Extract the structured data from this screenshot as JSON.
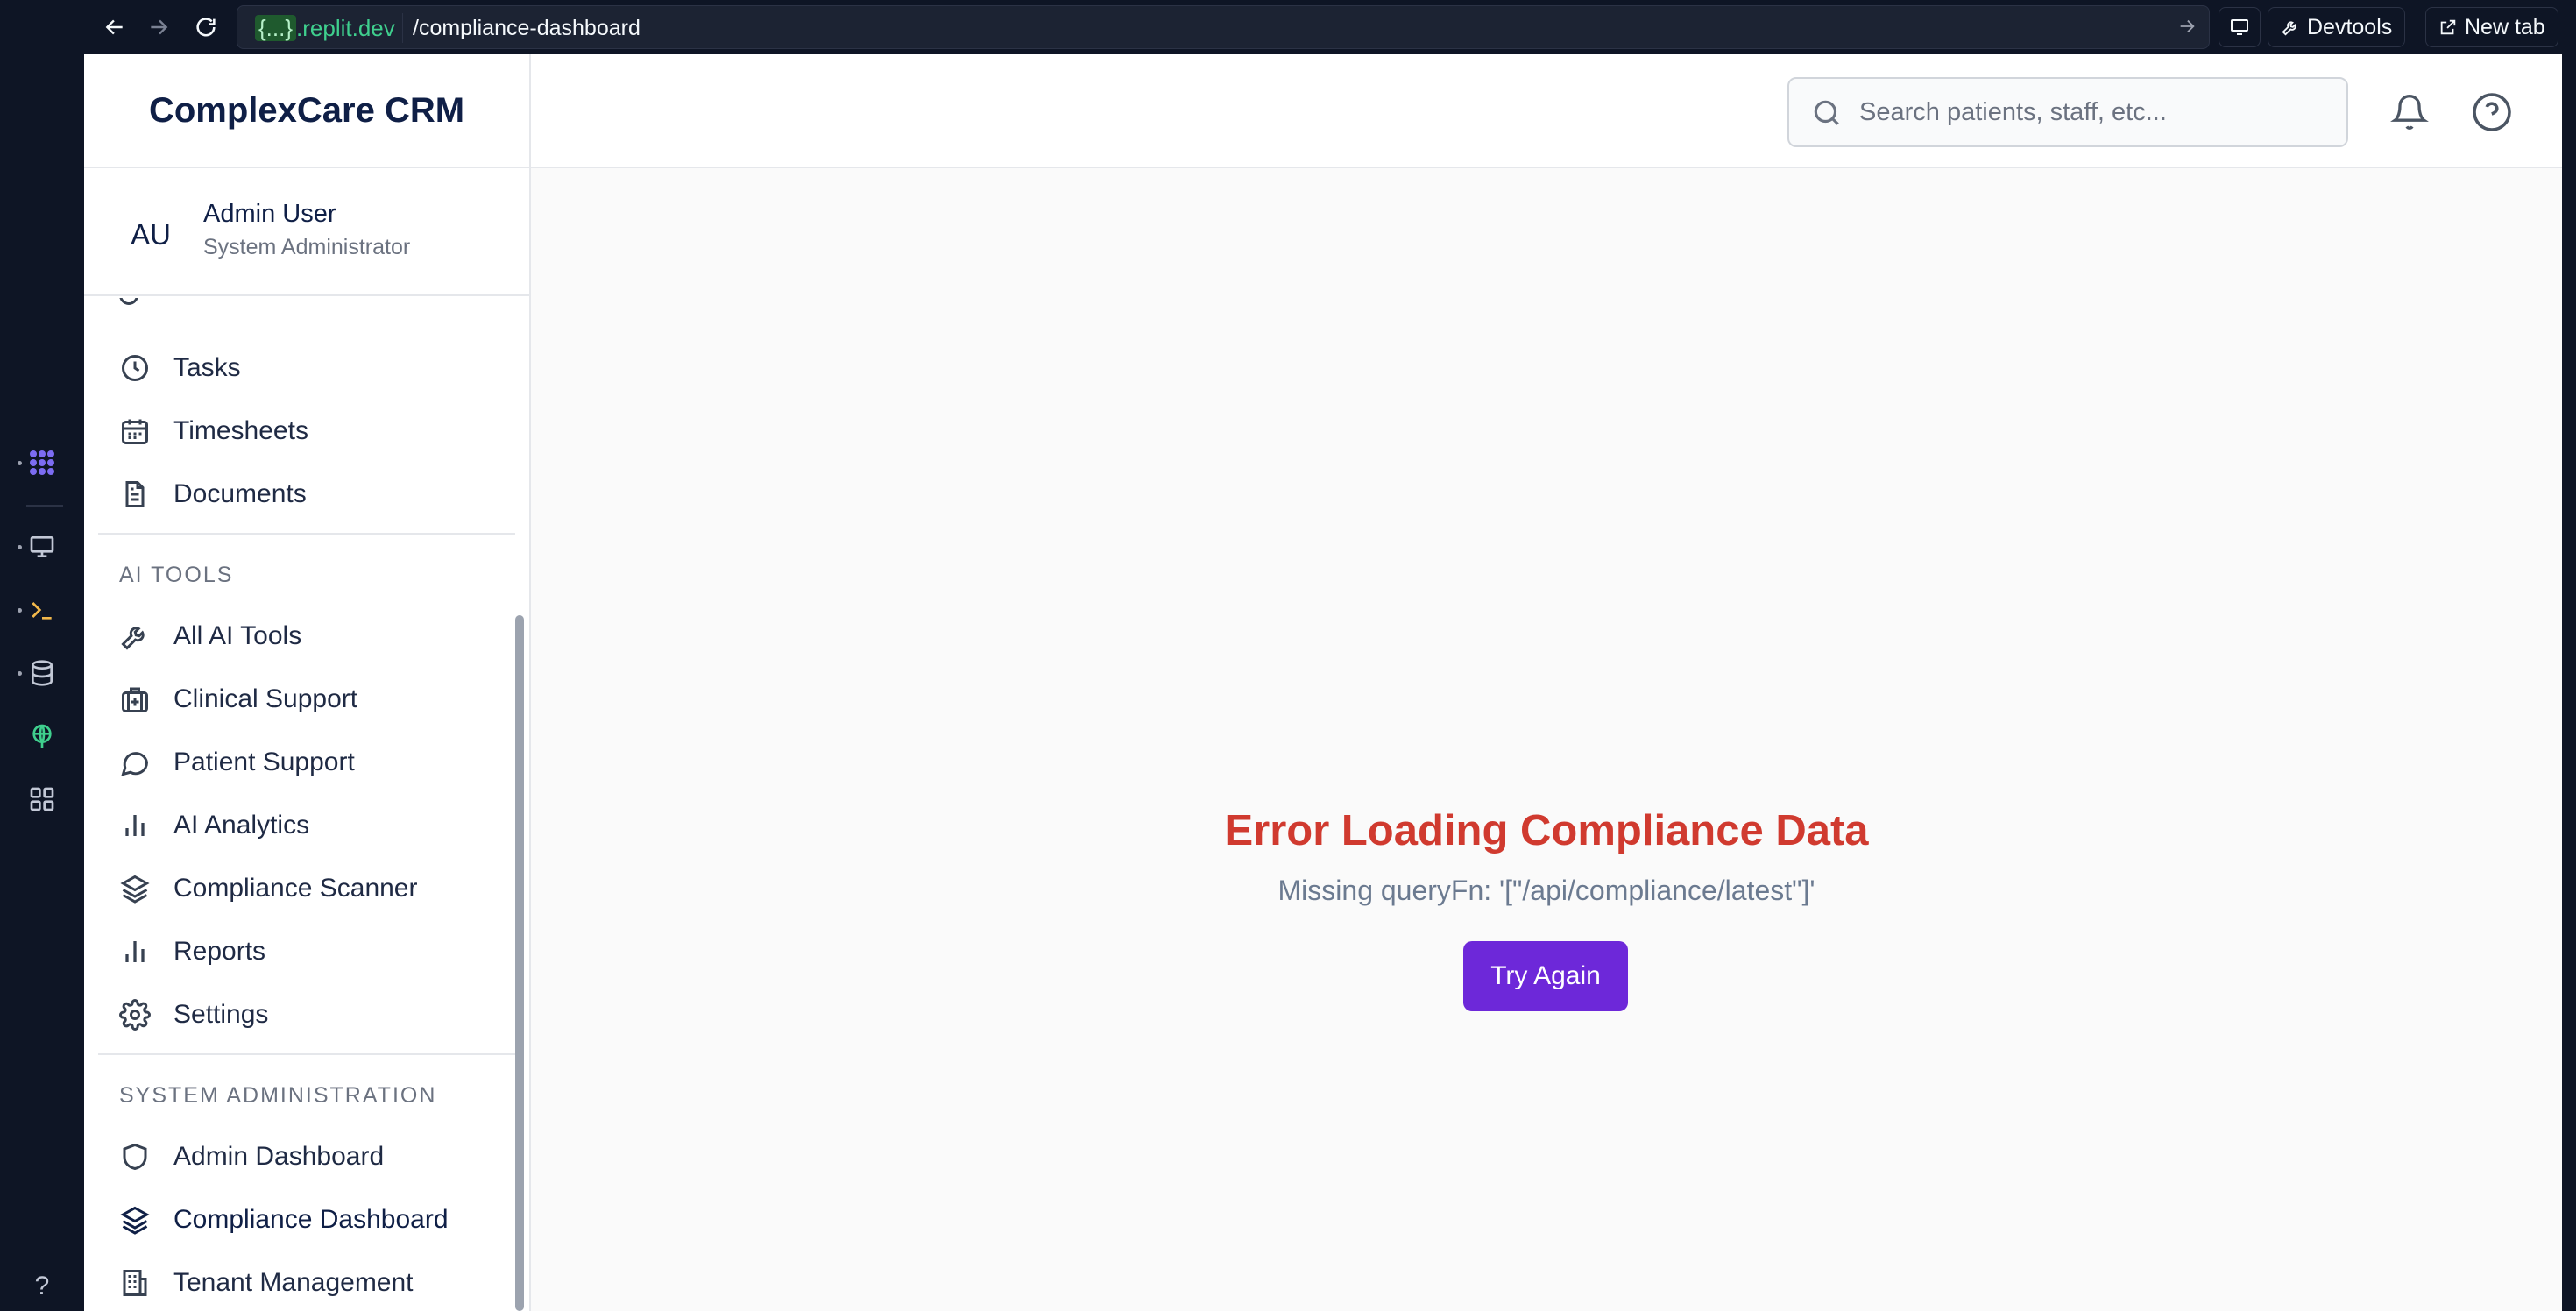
{
  "browser": {
    "url_host_prefix": "{...}",
    "url_host_suffix": ".replit.dev",
    "url_path": "/compliance-dashboard",
    "devtools_label": "Devtools",
    "new_tab_label": "New tab"
  },
  "app": {
    "brand": "ComplexCare CRM",
    "user": {
      "initials": "AU",
      "name": "Admin User",
      "role": "System Administrator"
    },
    "search_placeholder": "Search patients, staff, etc...",
    "nav_main": [
      {
        "label": "Tasks",
        "icon": "clock-icon"
      },
      {
        "label": "Timesheets",
        "icon": "calendar-icon"
      },
      {
        "label": "Documents",
        "icon": "document-icon"
      }
    ],
    "section_ai": "AI TOOLS",
    "nav_ai": [
      {
        "label": "All AI Tools",
        "icon": "wrench-icon"
      },
      {
        "label": "Clinical Support",
        "icon": "medical-bag-icon"
      },
      {
        "label": "Patient Support",
        "icon": "chat-bubble-icon"
      },
      {
        "label": "AI Analytics",
        "icon": "bar-chart-icon"
      },
      {
        "label": "Compliance Scanner",
        "icon": "layers-icon"
      },
      {
        "label": "Reports",
        "icon": "bar-chart-icon"
      },
      {
        "label": "Settings",
        "icon": "gear-icon"
      }
    ],
    "section_admin": "SYSTEM ADMINISTRATION",
    "nav_admin": [
      {
        "label": "Admin Dashboard",
        "icon": "shield-icon"
      },
      {
        "label": "Compliance Dashboard",
        "icon": "layers-icon"
      },
      {
        "label": "Tenant Management",
        "icon": "building-icon"
      }
    ],
    "error": {
      "title": "Error Loading Compliance Data",
      "message": "Missing queryFn: '[\"/api/compliance/latest\"]'",
      "retry_label": "Try Again"
    },
    "tooltip": "webview"
  },
  "colors": {
    "brand_text": "#0f1f46",
    "error": "#d03a2f",
    "primary": "#6d28d9"
  }
}
